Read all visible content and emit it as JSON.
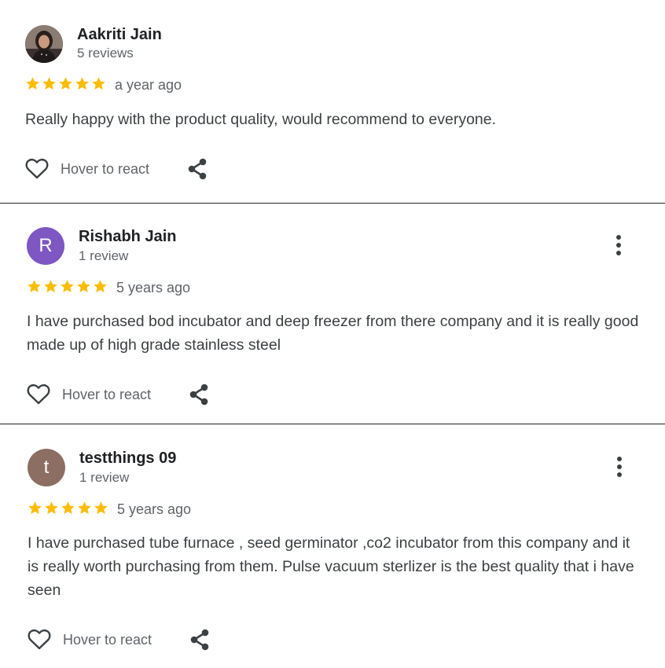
{
  "reviews": [
    {
      "name": "Aakriti Jain",
      "count": "5 reviews",
      "time": "a year ago",
      "text": "Really happy with the product quality, would recommend to everyone.",
      "react": "Hover to react",
      "avatar_icon": "profile-photo"
    },
    {
      "name": "Rishabh Jain",
      "count": "1 review",
      "time": "5 years ago",
      "text": "I have purchased bod incubator and deep freezer from there company and it is really good made up of high grade stainless steel",
      "react": "Hover to react",
      "avatar_letter": "R",
      "avatar_color": "#7e57c2"
    },
    {
      "name": "testthings 09",
      "count": "1 review",
      "time": "5 years ago",
      "text": "I have purchased tube furnace , seed germinator ,co2 incubator from this company and it is really worth purchasing from them. Pulse vacuum sterlizer is the best quality that i have seen",
      "react": "Hover to react",
      "avatar_letter": "t",
      "avatar_color": "#8d6e63"
    }
  ],
  "rating_out_of_5": [
    5,
    5,
    5
  ],
  "colors": {
    "star": "#fbbc04",
    "icon": "#3c4043"
  }
}
